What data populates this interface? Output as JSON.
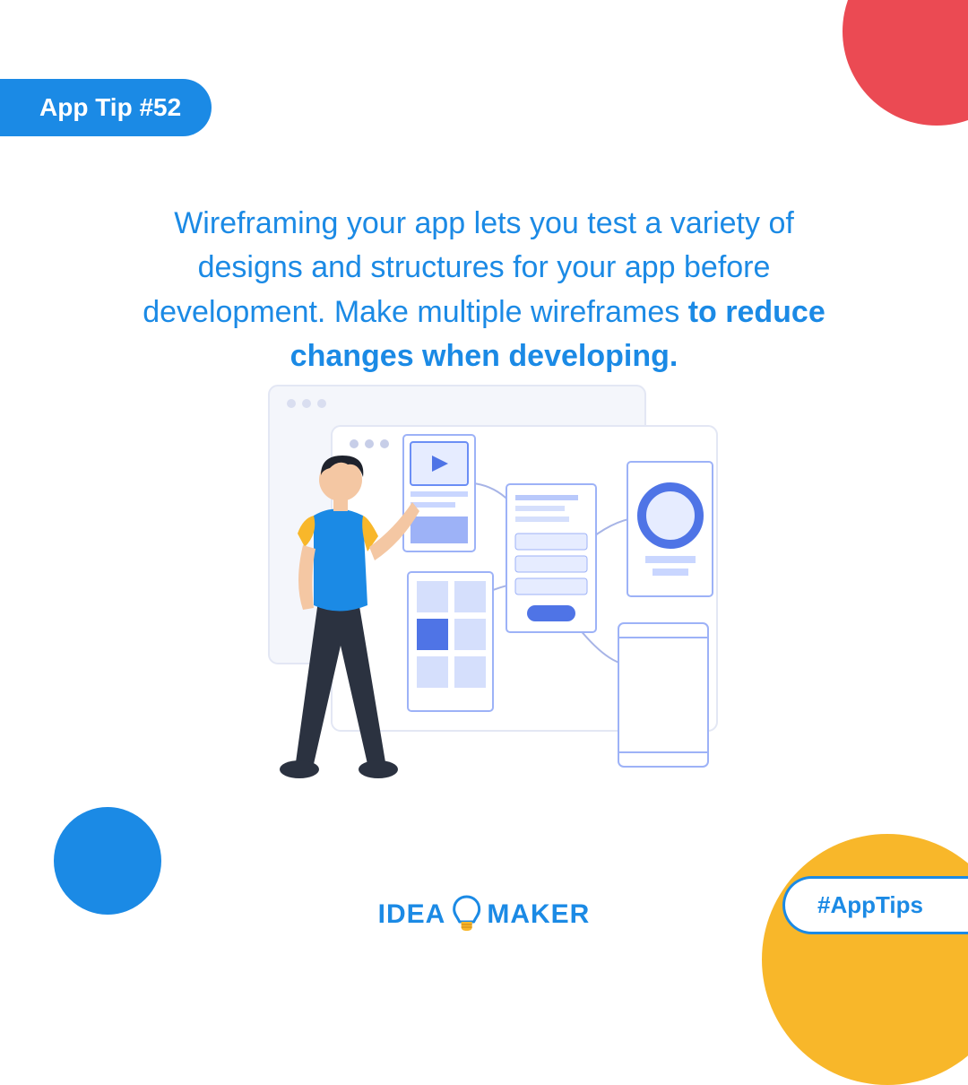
{
  "badge": {
    "label": "App Tip #52"
  },
  "tip": {
    "text_normal": "Wireframing your app lets you test a variety of designs and structures for your app before development. Make multiple wireframes ",
    "text_bold": "to reduce changes when developing."
  },
  "logo": {
    "left": "IDEA",
    "right": "MAKER"
  },
  "hashtag": {
    "label": "#AppTips"
  },
  "colors": {
    "blue": "#1b8ae5",
    "red": "#eb4a53",
    "yellow": "#f8b72a"
  }
}
